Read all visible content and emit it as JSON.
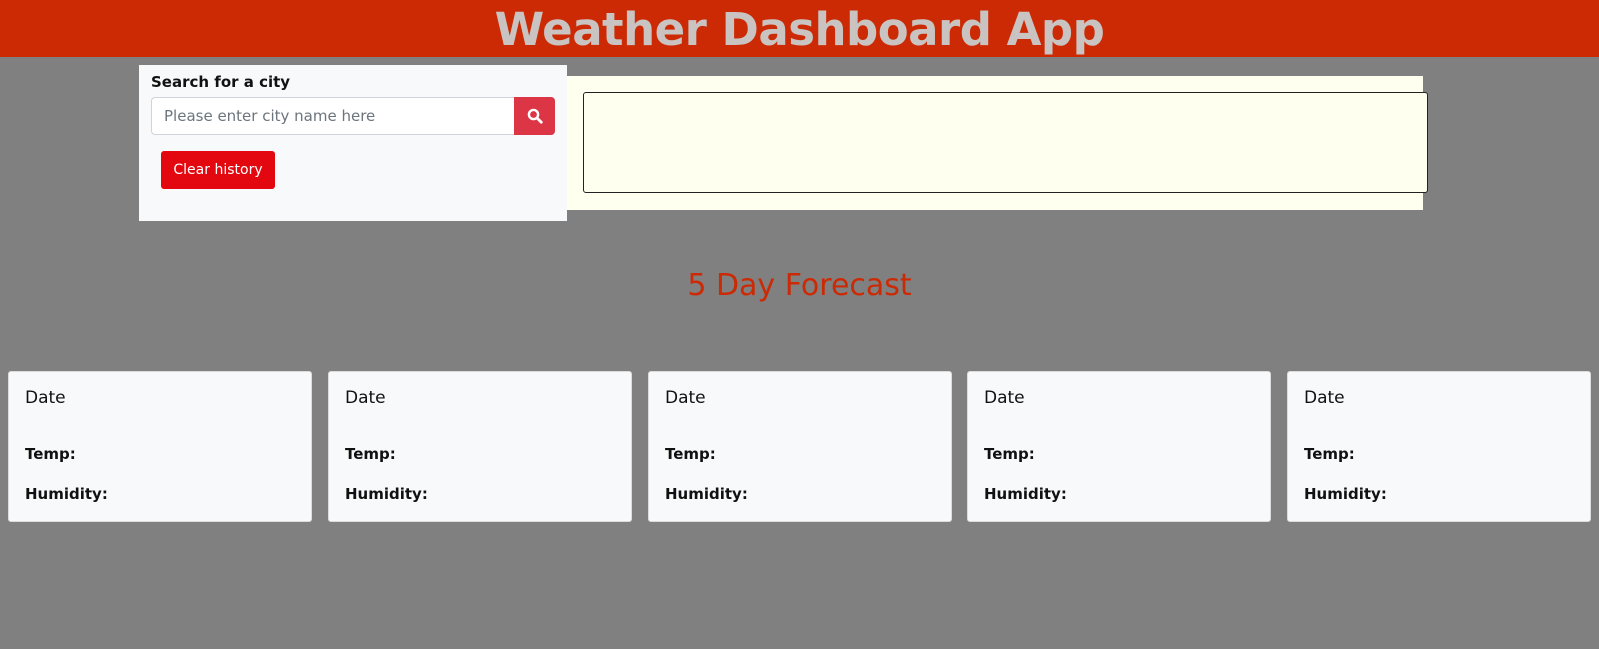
{
  "header": {
    "title": "Weather Dashboard App"
  },
  "search": {
    "label": "Search for a city",
    "placeholder": "Please enter city name here",
    "value": "",
    "button_icon": "search-icon",
    "clear_label": "Clear history"
  },
  "forecast": {
    "title": "5 Day Forecast",
    "cards": [
      {
        "date": "Date",
        "temp_label": "Temp:",
        "humidity_label": "Humidity:"
      },
      {
        "date": "Date",
        "temp_label": "Temp:",
        "humidity_label": "Humidity:"
      },
      {
        "date": "Date",
        "temp_label": "Temp:",
        "humidity_label": "Humidity:"
      },
      {
        "date": "Date",
        "temp_label": "Temp:",
        "humidity_label": "Humidity:"
      },
      {
        "date": "Date",
        "temp_label": "Temp:",
        "humidity_label": "Humidity:"
      }
    ]
  },
  "colors": {
    "header_bg": "#cc2a04",
    "header_text": "#c9c4c1",
    "page_bg": "#808080",
    "search_button": "#dc3545",
    "clear_button": "#e3070f",
    "forecast_title": "#cc2a04",
    "current_weather_bg": "#fffff0"
  }
}
